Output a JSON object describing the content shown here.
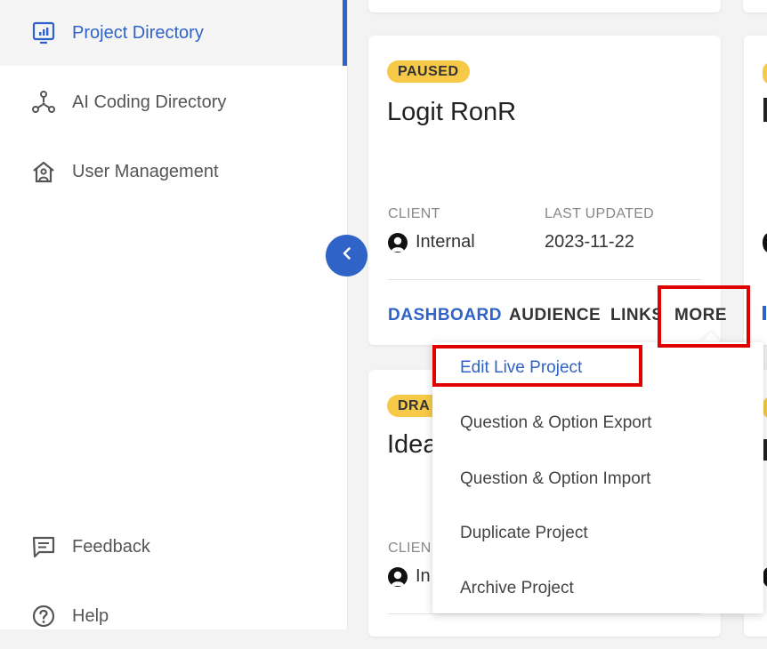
{
  "sidebar": {
    "items": [
      {
        "label": "Project Directory",
        "icon": "chart-icon",
        "active": true
      },
      {
        "label": "AI Coding Directory",
        "icon": "network-icon"
      },
      {
        "label": "User Management",
        "icon": "house-user-icon"
      }
    ],
    "bottom": [
      {
        "label": "Feedback",
        "icon": "feedback-icon"
      },
      {
        "label": "Help",
        "icon": "help-icon"
      }
    ]
  },
  "card1": {
    "status": "PAUSED",
    "title": "Logit RonR",
    "client_label": "CLIENT",
    "client_value": "Internal",
    "updated_label": "LAST UPDATED",
    "updated_value": "2023-11-22",
    "actions": [
      "DASHBOARD",
      "AUDIENCE",
      "LINKS",
      "MORE"
    ]
  },
  "card2": {
    "status": "DRA",
    "title": "Idea",
    "client_label": "CLIEN",
    "client_value": "In"
  },
  "more_menu": {
    "items": [
      "Edit Live Project",
      "Question & Option Export",
      "Question & Option Import",
      "Duplicate Project",
      "Archive Project"
    ]
  },
  "colors": {
    "accent": "#2f63c8",
    "badge": "#f7c948",
    "highlight": "#e00000"
  }
}
